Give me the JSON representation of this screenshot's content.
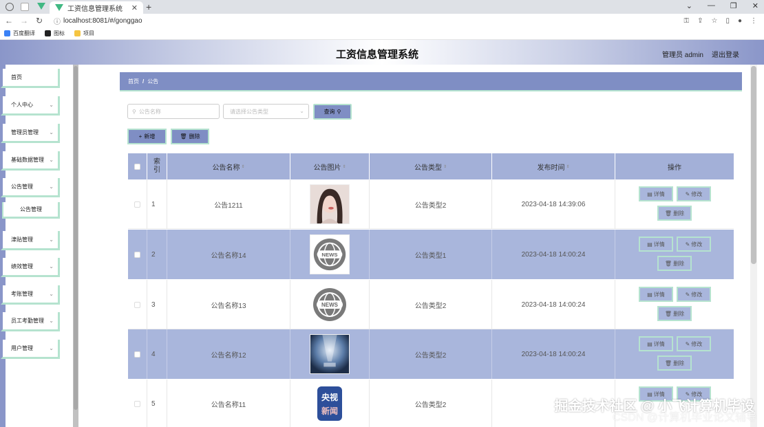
{
  "browser": {
    "tab_title": "工资信息管理系统",
    "url": "localhost:8081/#/gonggao",
    "bookmarks": [
      "百度翻译",
      "图标",
      "项目"
    ]
  },
  "header": {
    "title": "工资信息管理系统",
    "user": "管理员 admin",
    "logout": "退出登录"
  },
  "sidebar": {
    "items": [
      {
        "label": "首页"
      },
      {
        "label": "个人中心"
      },
      {
        "label": "管理员管理"
      },
      {
        "label": "基础数据管理"
      },
      {
        "label": "公告管理"
      },
      {
        "label": "公告管理"
      },
      {
        "label": "津贴管理"
      },
      {
        "label": "绩效管理"
      },
      {
        "label": "考账管理"
      },
      {
        "label": "员工考勤管理"
      },
      {
        "label": "用户管理"
      }
    ]
  },
  "breadcrumb": {
    "home": "首页",
    "sep": "/",
    "current": "公告"
  },
  "search": {
    "name_placeholder": "公告名称",
    "type_placeholder": "请选择公告类型",
    "query_label": "查询"
  },
  "toolbar": {
    "add_label": "新增",
    "delete_label": "删除"
  },
  "table": {
    "columns": [
      "索引",
      "公告名称",
      "公告图片",
      "公告类型",
      "发布时间",
      "操作"
    ],
    "rows": [
      {
        "index": "1",
        "name": "公告1211",
        "type": "公告类型2",
        "time": "2023-04-18 14:39:06"
      },
      {
        "index": "2",
        "name": "公告名称14",
        "type": "公告类型1",
        "time": "2023-04-18 14:00:24"
      },
      {
        "index": "3",
        "name": "公告名称13",
        "type": "公告类型2",
        "time": "2023-04-18 14:00:24"
      },
      {
        "index": "4",
        "name": "公告名称12",
        "type": "公告类型2",
        "time": "2023-04-18 14:00:24"
      },
      {
        "index": "5",
        "name": "公告名称11",
        "type": "公告类型2",
        "time": ""
      }
    ],
    "actions": {
      "detail": "详情",
      "edit": "修改",
      "delete": "删除"
    },
    "thumb_texts": {
      "news": "NEWS",
      "cctv_top": "央视",
      "cctv_bottom": "新闻"
    }
  },
  "watermark": {
    "line1": "掘金技术社区 @ 小飞计算机毕设",
    "line2": "CSDN @计算机毕业论文辅导"
  },
  "colors": {
    "accent": "#7f8ec4",
    "row_alt": "#a9b6dc",
    "border_green": "#b5e3cf"
  }
}
